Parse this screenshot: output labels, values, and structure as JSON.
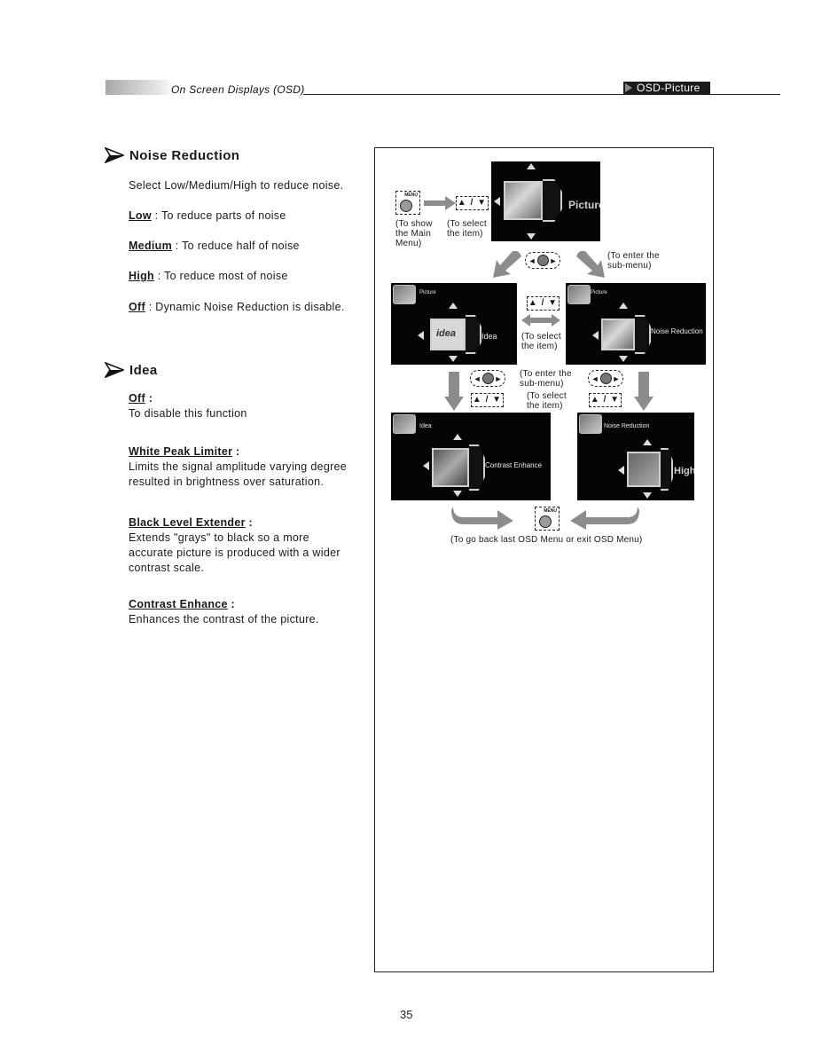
{
  "header": {
    "section_title": "On Screen Displays (OSD)",
    "tag": "OSD-Picture"
  },
  "noise_reduction": {
    "title": "Noise Reduction",
    "intro": "Select Low/Medium/High to reduce noise.",
    "options": [
      {
        "term": "Low",
        "desc": " : To reduce parts of noise"
      },
      {
        "term": "Medium",
        "desc": " : To reduce half of noise"
      },
      {
        "term": "High",
        "desc": " : To reduce most of noise"
      },
      {
        "term": "Off",
        "desc": " : Dynamic Noise Reduction is disable."
      }
    ]
  },
  "idea": {
    "title": "Idea",
    "options": [
      {
        "term": "Off",
        "colon": " :",
        "desc": [
          "To disable this function"
        ]
      },
      {
        "term": "White Peak Limiter",
        "colon": " :",
        "desc": [
          "Limits the signal amplitude varying degree",
          "resulted in brightness over saturation."
        ]
      },
      {
        "term": "Black Level Extender",
        "colon": " :",
        "desc": [
          "Extends \"grays\" to black so a more",
          "accurate picture is produced with a wider",
          "contrast scale."
        ]
      },
      {
        "term": "Contrast Enhance",
        "colon": " :",
        "desc": [
          "Enhances the contrast of the picture."
        ]
      }
    ]
  },
  "diagram": {
    "menu_button_caption": "MENU",
    "updown_label": "▲ / ▼",
    "notes": {
      "show_main_menu": [
        "(To show",
        "the Main",
        "Menu)"
      ],
      "select_item_top": [
        "(To select",
        "the item)"
      ],
      "enter_submenu_top": [
        "(To enter the",
        "sub-menu)"
      ],
      "select_item_mid": [
        "(To select",
        "the item)"
      ],
      "enter_submenu_mid": [
        "(To enter the",
        "sub-menu)"
      ],
      "select_item_low": [
        "(To select",
        "the item)"
      ],
      "go_back": "(To go back last OSD Menu or exit OSD Menu)"
    },
    "screens": {
      "main": {
        "item": "Picture"
      },
      "idea": {
        "parent": "Picture",
        "item": "Idea",
        "icon_text": "idea"
      },
      "noise": {
        "parent": "Picture",
        "item": "Noise Reduction"
      },
      "contrast": {
        "parent": "Idea",
        "item": "Contrast Enhance"
      },
      "high": {
        "parent": "Noise Reduction",
        "item": "High"
      }
    }
  },
  "page_number": "35"
}
